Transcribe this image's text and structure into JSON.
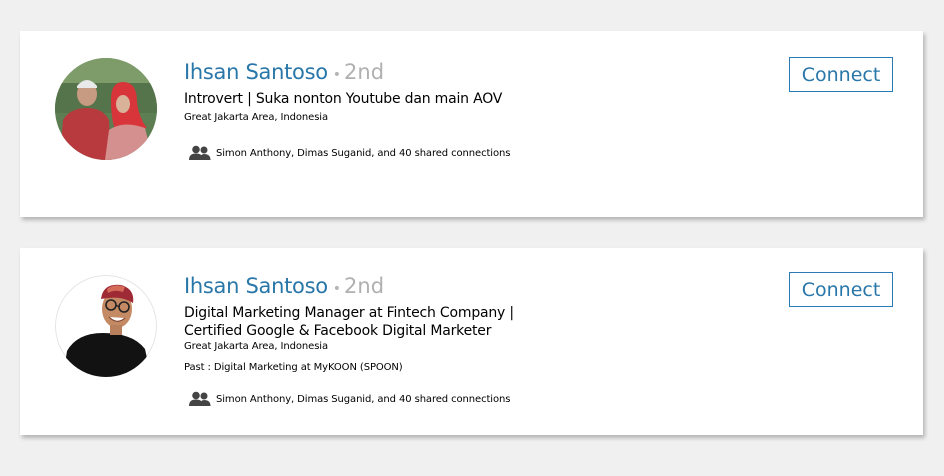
{
  "results": [
    {
      "name": "Ihsan Santoso",
      "separator": "•",
      "degree": "2nd",
      "headline": "Introvert | Suka nonton Youtube dan main AOV",
      "location": "Great Jakarta Area, Indonesia",
      "shared_connections": "Simon Anthony, Dimas Suganid, and 40 shared connections",
      "connect_label": "Connect"
    },
    {
      "name": "Ihsan Santoso",
      "separator": "•",
      "degree": "2nd",
      "headline_line1": "Digital Marketing Manager at Fintech Company |",
      "headline_line2": "Certified Google & Facebook Digital Marketer",
      "location": "Great Jakarta Area, Indonesia",
      "past_label": "Past :",
      "past_value": "Digital Marketing at MyKOON (SPOON)",
      "shared_connections": "Simon Anthony, Dimas Suganid, and 40 shared connections",
      "connect_label": "Connect"
    }
  ],
  "colors": {
    "name": "#2977a9",
    "degree": "#b0b0b0",
    "button_border": "#2a7bb3",
    "background": "#f0f0f0"
  },
  "icons": {
    "connections": "people-icon"
  }
}
